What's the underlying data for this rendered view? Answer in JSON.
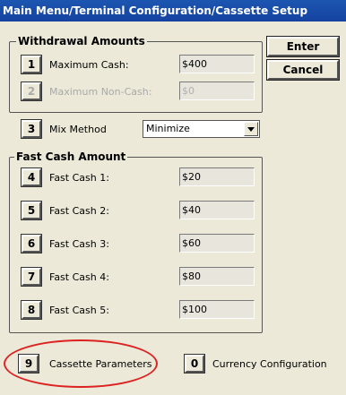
{
  "window": {
    "title": "Main Menu/Terminal Configuration/Cassette Setup"
  },
  "withdrawal": {
    "title": "Withdrawal Amounts",
    "items": [
      {
        "num": "1",
        "label": "Maximum Cash:",
        "value": "$400",
        "enabled": true
      },
      {
        "num": "2",
        "label": "Maximum Non-Cash:",
        "value": "$0",
        "enabled": false
      }
    ]
  },
  "buttons": {
    "enter": "Enter",
    "cancel": "Cancel"
  },
  "mix": {
    "num": "3",
    "label": "Mix Method",
    "value": "Minimize"
  },
  "fastcash": {
    "title": "Fast Cash Amount",
    "items": [
      {
        "num": "4",
        "label": "Fast Cash 1:",
        "value": "$20"
      },
      {
        "num": "5",
        "label": "Fast Cash 2:",
        "value": "$40"
      },
      {
        "num": "6",
        "label": "Fast Cash 3:",
        "value": "$60"
      },
      {
        "num": "7",
        "label": "Fast Cash 4:",
        "value": "$80"
      },
      {
        "num": "8",
        "label": "Fast Cash 5:",
        "value": "$100"
      }
    ]
  },
  "bottom": {
    "cassette": {
      "num": "9",
      "label": "Cassette Parameters"
    },
    "currency": {
      "num": "0",
      "label": "Currency Configuration"
    }
  },
  "colors": {
    "titlebar": "#1c56b0",
    "highlight": "#dd2222",
    "background": "#ece9d8"
  }
}
